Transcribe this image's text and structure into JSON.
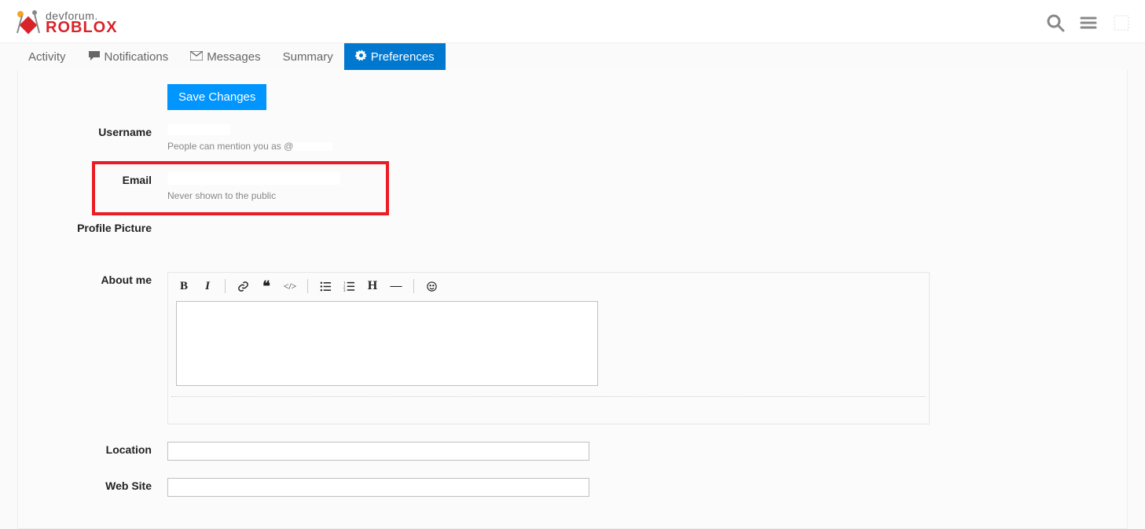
{
  "header": {
    "logo_top": "devforum.",
    "logo_bot": "ROBLOX"
  },
  "tabs": {
    "activity": "Activity",
    "notifications": "Notifications",
    "messages": "Messages",
    "summary": "Summary",
    "preferences": "Preferences"
  },
  "prefs": {
    "save_label": "Save Changes",
    "username_label": "Username",
    "username_value": "",
    "mention_hint": "People can mention you as @",
    "mention_handle": "",
    "email_label": "Email",
    "email_value": "",
    "email_hint": "Never shown to the public",
    "pp_label": "Profile Picture",
    "about_label": "About me",
    "about_value": "",
    "location_label": "Location",
    "location_value": "",
    "website_label": "Web Site",
    "website_value": ""
  }
}
